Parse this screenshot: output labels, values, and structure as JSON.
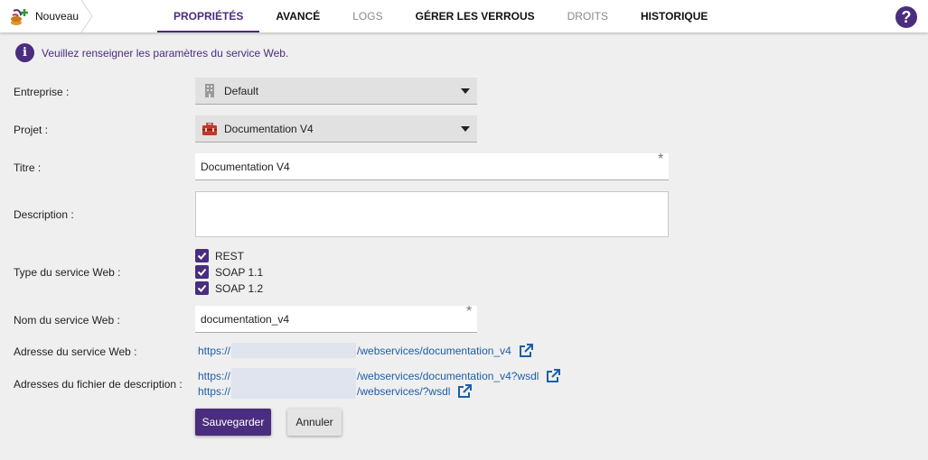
{
  "breadcrumb": {
    "label": "Nouveau",
    "icon": "new-webservice-icon"
  },
  "tabs": [
    {
      "label": "PROPRIÉTÉS",
      "state": "active"
    },
    {
      "label": "AVANCÉ",
      "state": "normal"
    },
    {
      "label": "LOGS",
      "state": "disabled"
    },
    {
      "label": "GÉRER LES VERROUS",
      "state": "normal"
    },
    {
      "label": "DROITS",
      "state": "disabled"
    },
    {
      "label": "HISTORIQUE",
      "state": "normal"
    }
  ],
  "help": {
    "glyph": "?"
  },
  "info": {
    "glyph": "i",
    "text": "Veuillez renseigner les paramètres du service Web."
  },
  "form": {
    "entreprise": {
      "label": "Entreprise :",
      "value": "Default",
      "icon": "building-icon"
    },
    "projet": {
      "label": "Projet :",
      "value": "Documentation V4",
      "icon": "toolbox-icon"
    },
    "titre": {
      "label": "Titre :",
      "value": "Documentation V4",
      "required": "*"
    },
    "description": {
      "label": "Description :",
      "value": ""
    },
    "type": {
      "label": "Type du service Web :",
      "options": [
        {
          "label": "REST",
          "checked": true
        },
        {
          "label": "SOAP 1.1",
          "checked": true
        },
        {
          "label": "SOAP 1.2",
          "checked": true
        }
      ]
    },
    "nom": {
      "label": "Nom du service Web :",
      "value": "documentation_v4",
      "required": "*"
    },
    "adresse": {
      "label": "Adresse du service Web :",
      "prefix": "https://",
      "suffix": "/webservices/documentation_v4"
    },
    "fichiers": {
      "label": "Adresses du fichier de description :",
      "links": [
        {
          "prefix": "https://",
          "suffix": "/webservices/documentation_v4?wsdl"
        },
        {
          "prefix": "https://",
          "suffix": "/webservices/?wsdl"
        }
      ]
    }
  },
  "buttons": {
    "save": "Sauvegarder",
    "cancel": "Annuler"
  },
  "colors": {
    "accent": "#4a2d7e",
    "link": "#1d5fa8",
    "background": "#efefef"
  }
}
